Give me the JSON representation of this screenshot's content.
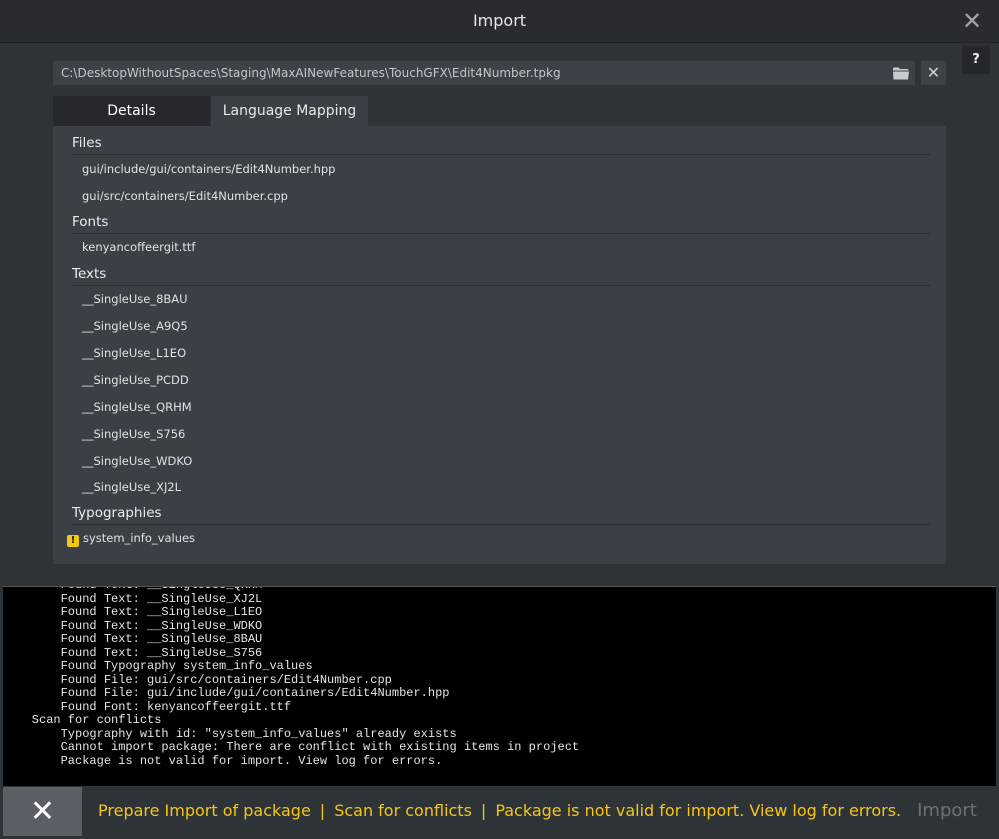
{
  "window": {
    "title": "Import",
    "close_glyph": "✕",
    "help_label": "?"
  },
  "package_path": {
    "value": "C:\\DesktopWithoutSpaces\\Staging\\MaxAINewFeatures\\TouchGFX\\Edit4Number.tpkg",
    "folder_icon": "folder-icon",
    "clear_glyph": "✕"
  },
  "tabs": [
    {
      "label": "Details",
      "active": true
    },
    {
      "label": "Language Mapping",
      "active": false
    }
  ],
  "details": {
    "files_header": "Files",
    "files": [
      "gui/include/gui/containers/Edit4Number.hpp",
      "gui/src/containers/Edit4Number.cpp"
    ],
    "fonts_header": "Fonts",
    "fonts": [
      "kenyancoffeergit.ttf"
    ],
    "texts_header": "Texts",
    "texts": [
      "__SingleUse_8BAU",
      "__SingleUse_A9Q5",
      "__SingleUse_L1EO",
      "__SingleUse_PCDD",
      "__SingleUse_QRHM",
      "__SingleUse_S756",
      "__SingleUse_WDKO",
      "__SingleUse_XJ2L"
    ],
    "typographies_header": "Typographies",
    "typographies": [
      {
        "name": "system_info_values",
        "warning": true,
        "warning_glyph": "!"
      }
    ]
  },
  "log": [
    "        Found Text: __SingleUse_QRHM",
    "        Found Text: __SingleUse_XJ2L",
    "        Found Text: __SingleUse_L1EO",
    "        Found Text: __SingleUse_WDKO",
    "        Found Text: __SingleUse_8BAU",
    "        Found Text: __SingleUse_S756",
    "        Found Typography system_info_values",
    "        Found File: gui/src/containers/Edit4Number.cpp",
    "        Found File: gui/include/gui/containers/Edit4Number.hpp",
    "        Found Font: kenyancoffeergit.ttf",
    "    Scan for conflicts",
    "        Typography with id: \"system_info_values\" already exists",
    "        Cannot import package: There are conflict with existing items in project",
    "        Package is not valid for import. View log for errors."
  ],
  "footer": {
    "cancel_glyph": "✕",
    "status_parts": [
      "Prepare Import of package",
      "Scan for conflicts",
      "Package is not valid for import. View log for errors."
    ],
    "separator": "|",
    "import_label": "Import"
  },
  "colors": {
    "status_text": "#f5c518",
    "warning": "#f2c811",
    "background": "#2e3338",
    "console": "#000000"
  }
}
